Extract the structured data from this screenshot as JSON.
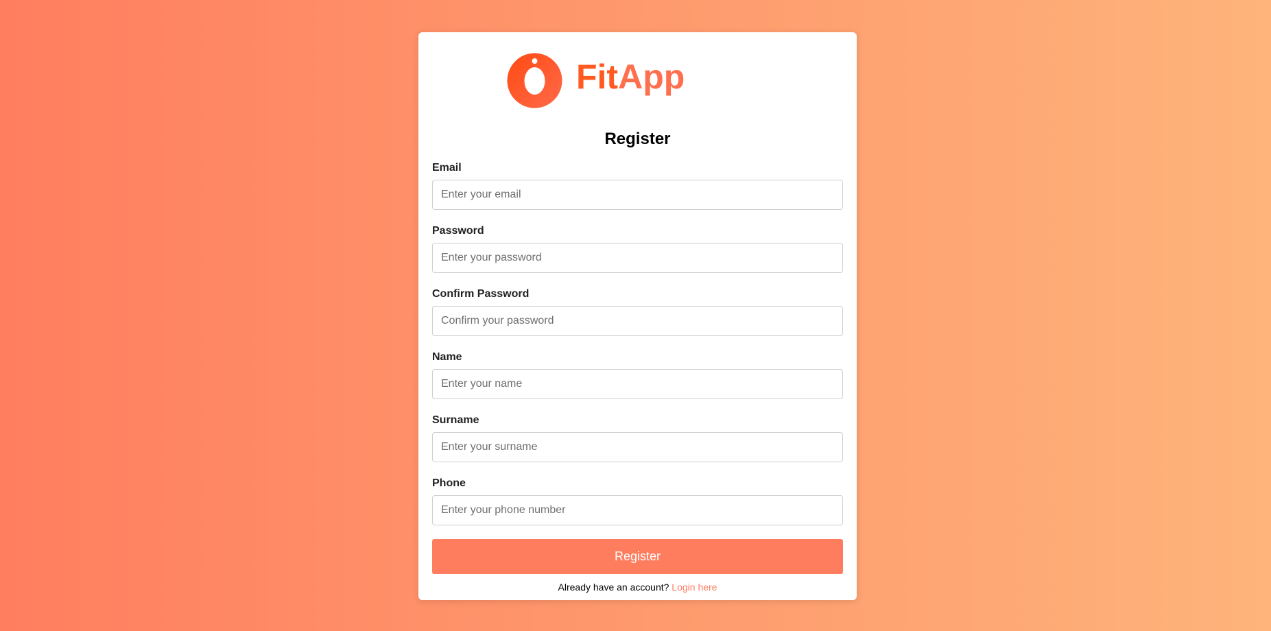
{
  "brand": {
    "name_part1": "Fit",
    "name_part2": "App",
    "primary_color": "#ff5a1f",
    "accent_color": "#ff7d5f"
  },
  "page": {
    "title": "Register"
  },
  "form": {
    "fields": [
      {
        "label": "Email",
        "placeholder": "Enter your email",
        "value": ""
      },
      {
        "label": "Password",
        "placeholder": "Enter your password",
        "value": ""
      },
      {
        "label": "Confirm Password",
        "placeholder": "Confirm your password",
        "value": ""
      },
      {
        "label": "Name",
        "placeholder": "Enter your name",
        "value": ""
      },
      {
        "label": "Surname",
        "placeholder": "Enter your surname",
        "value": ""
      },
      {
        "label": "Phone",
        "placeholder": "Enter your phone number",
        "value": ""
      }
    ],
    "submit_label": "Register"
  },
  "footer": {
    "prompt": "Already have an account?",
    "link_label": "Login here"
  }
}
